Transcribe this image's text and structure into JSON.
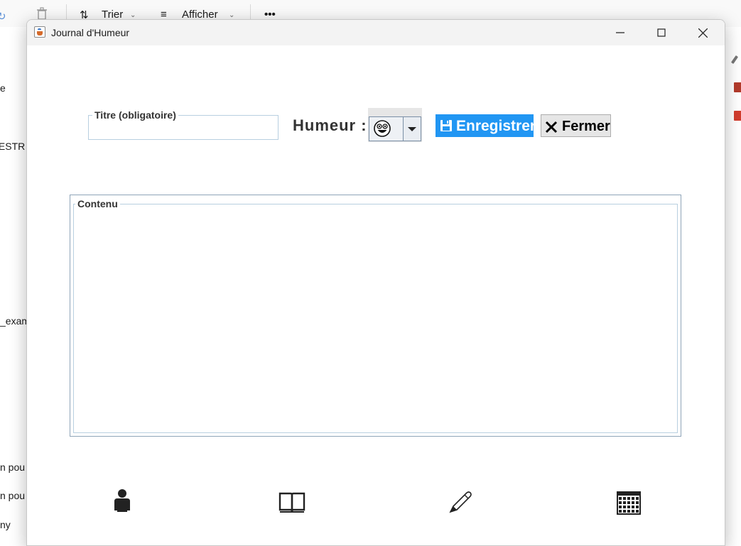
{
  "background_explorer": {
    "toolbar": {
      "sort_label": "Trier",
      "view_label": "Afficher"
    },
    "left_pane_fragments": [
      "e",
      "IESTR",
      "_exam",
      "n pou",
      "n pou",
      "ny"
    ]
  },
  "window": {
    "title": "Journal d'Humeur"
  },
  "form": {
    "title_field_label": "Titre (obligatoire)",
    "title_field_value": "",
    "mood_label": "Humeur :",
    "mood_selected_icon": "laughing-face-icon",
    "save_label": "Enregistrer",
    "close_label": "Fermer",
    "content_label": "Contenu",
    "content_value": ""
  },
  "bottom_nav": [
    {
      "icon": "user-icon"
    },
    {
      "icon": "book-icon"
    },
    {
      "icon": "pen-icon"
    },
    {
      "icon": "calendar-icon"
    }
  ]
}
